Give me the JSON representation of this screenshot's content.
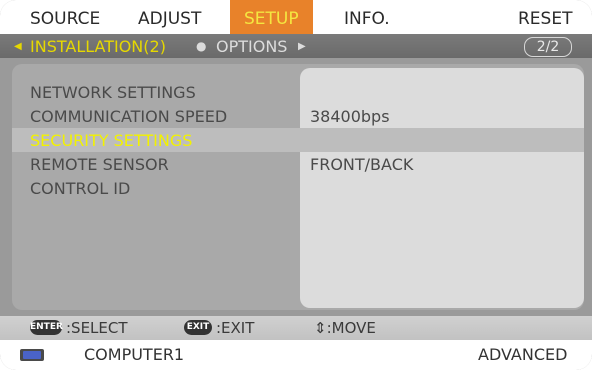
{
  "tabs": [
    {
      "label": "SOURCE"
    },
    {
      "label": "ADJUST"
    },
    {
      "label": "SETUP"
    },
    {
      "label": "INFO."
    },
    {
      "label": "RESET"
    }
  ],
  "subbar": {
    "current": "INSTALLATION(2)",
    "next": "OPTIONS",
    "page": "2/2"
  },
  "menu": [
    {
      "label": "NETWORK SETTINGS",
      "value": ""
    },
    {
      "label": "COMMUNICATION SPEED",
      "value": "38400bps"
    },
    {
      "label": "SECURITY SETTINGS",
      "value": ""
    },
    {
      "label": "REMOTE SENSOR",
      "value": "FRONT/BACK"
    },
    {
      "label": "CONTROL ID",
      "value": ""
    }
  ],
  "help": {
    "enter_badge": "ENTER",
    "enter_text": ":SELECT",
    "exit_badge": "EXIT",
    "exit_text": ":EXIT",
    "move_text": "⇕:MOVE"
  },
  "status": {
    "source": "COMPUTER1",
    "mode": "ADVANCED"
  },
  "colors": {
    "active_tab": "#e8822a",
    "highlight_text": "#f2f200",
    "subbar_text": "#e6d800"
  }
}
